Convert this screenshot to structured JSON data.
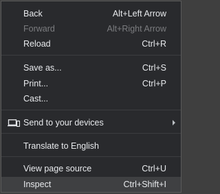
{
  "menu": {
    "back": {
      "label": "Back",
      "shortcut": "Alt+Left Arrow"
    },
    "forward": {
      "label": "Forward",
      "shortcut": "Alt+Right Arrow"
    },
    "reload": {
      "label": "Reload",
      "shortcut": "Ctrl+R"
    },
    "save_as": {
      "label": "Save as...",
      "shortcut": "Ctrl+S"
    },
    "print": {
      "label": "Print...",
      "shortcut": "Ctrl+P"
    },
    "cast": {
      "label": "Cast..."
    },
    "send_to_devices": {
      "label": "Send to your devices",
      "icon": "devices-icon"
    },
    "translate": {
      "label": "Translate to English"
    },
    "view_source": {
      "label": "View page source",
      "shortcut": "Ctrl+U"
    },
    "inspect": {
      "label": "Inspect",
      "shortcut": "Ctrl+Shift+I"
    }
  },
  "colors": {
    "menu_bg": "#292a2d",
    "text": "#e8eaed",
    "disabled_text": "#7b7c7f",
    "highlight_bg": "#3f4042",
    "separator": "#3c3d40"
  }
}
